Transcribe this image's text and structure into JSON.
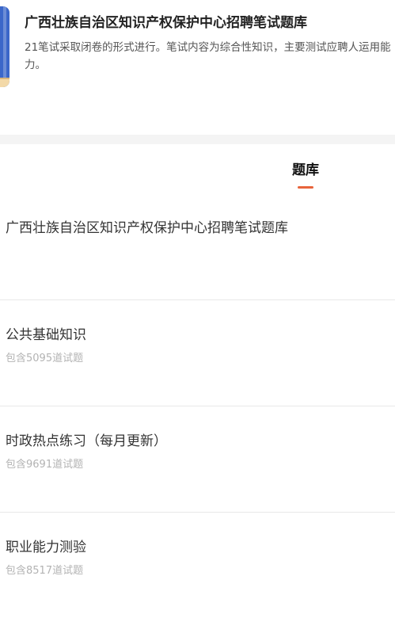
{
  "header": {
    "title": "广西壮族自治区知识产权保护中心招聘笔试题库",
    "description": "21笔试采取闭卷的形式进行。笔试内容为综合性知识，主要测试应聘人运用能力。"
  },
  "tabs": [
    {
      "label": "题库",
      "active": true
    }
  ],
  "bank": {
    "heading": "广西壮族自治区知识产权保护中心招聘笔试题库",
    "items": [
      {
        "name": "公共基础知识",
        "count_text": "包含5095道试题"
      },
      {
        "name": "时政热点练习（每月更新）",
        "count_text": "包含9691道试题"
      },
      {
        "name": "职业能力测验",
        "count_text": "包含8517道试题"
      }
    ]
  },
  "colors": {
    "accent": "#e8643b",
    "icon_blue": "#3b67c9",
    "muted_text": "#b3b3b3"
  }
}
